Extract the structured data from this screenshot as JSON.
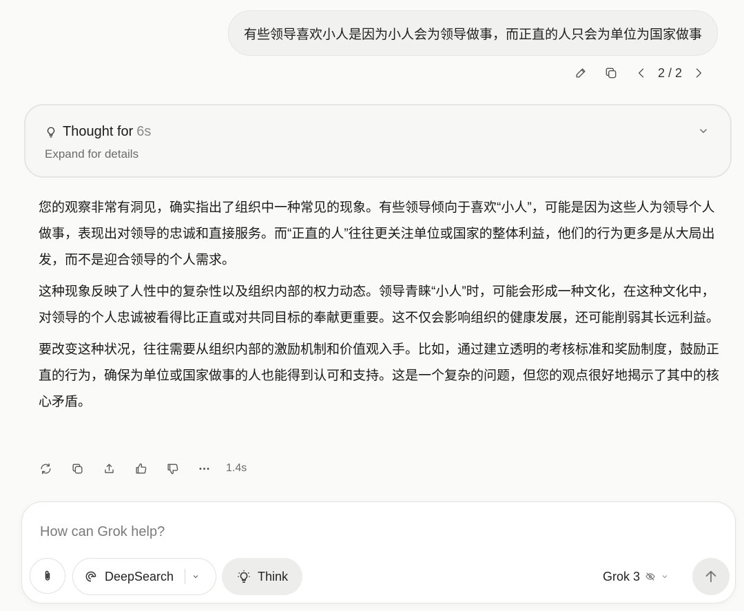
{
  "user_message": {
    "text": "有些领导喜欢小人是因为小人会为领导做事，而正直的人只会为单位为国家做事",
    "pager": "2 / 2",
    "icons": [
      "edit-icon",
      "copy-icon",
      "chevron-left-icon",
      "chevron-right-icon"
    ]
  },
  "thought": {
    "label": "Thought for",
    "duration": "6s",
    "expand_text": "Expand for details",
    "icons": [
      "lightbulb-icon",
      "chevron-down-icon"
    ]
  },
  "answer": {
    "paragraphs": [
      "您的观察非常有洞见，确实指出了组织中一种常见的现象。有些领导倾向于喜欢“小人”，可能是因为这些人为领导个人做事，表现出对领导的忠诚和直接服务。而“正直的人”往往更关注单位或国家的整体利益，他们的行为更多是从大局出发，而不是迎合领导的个人需求。",
      "这种现象反映了人性中的复杂性以及组织内部的权力动态。领导青睐“小人”时，可能会形成一种文化，在这种文化中，对领导的个人忠诚被看得比正直或对共同目标的奉献更重要。这不仅会影响组织的健康发展，还可能削弱其长远利益。",
      "要改变这种状况，往往需要从组织内部的激励机制和价值观入手。比如，通过建立透明的考核标准和奖励制度，鼓励正直的行为，确保为单位或国家做事的人也能得到认可和支持。这是一个复杂的问题，但您的观点很好地揭示了其中的核心矛盾。"
    ],
    "elapsed": "1.4s",
    "action_icons": [
      "regenerate-icon",
      "copy-icon",
      "share-icon",
      "thumbs-up-icon",
      "thumbs-down-icon",
      "more-icon"
    ]
  },
  "composer": {
    "placeholder": "How can Grok help?",
    "value": "",
    "deepsearch_label": "DeepSearch",
    "think_label": "Think",
    "model_name": "Grok 3",
    "icons": [
      "paperclip-icon",
      "deepsearch-icon",
      "lightbulb-icon",
      "private-icon",
      "chevron-down-icon",
      "send-arrow-icon"
    ]
  }
}
